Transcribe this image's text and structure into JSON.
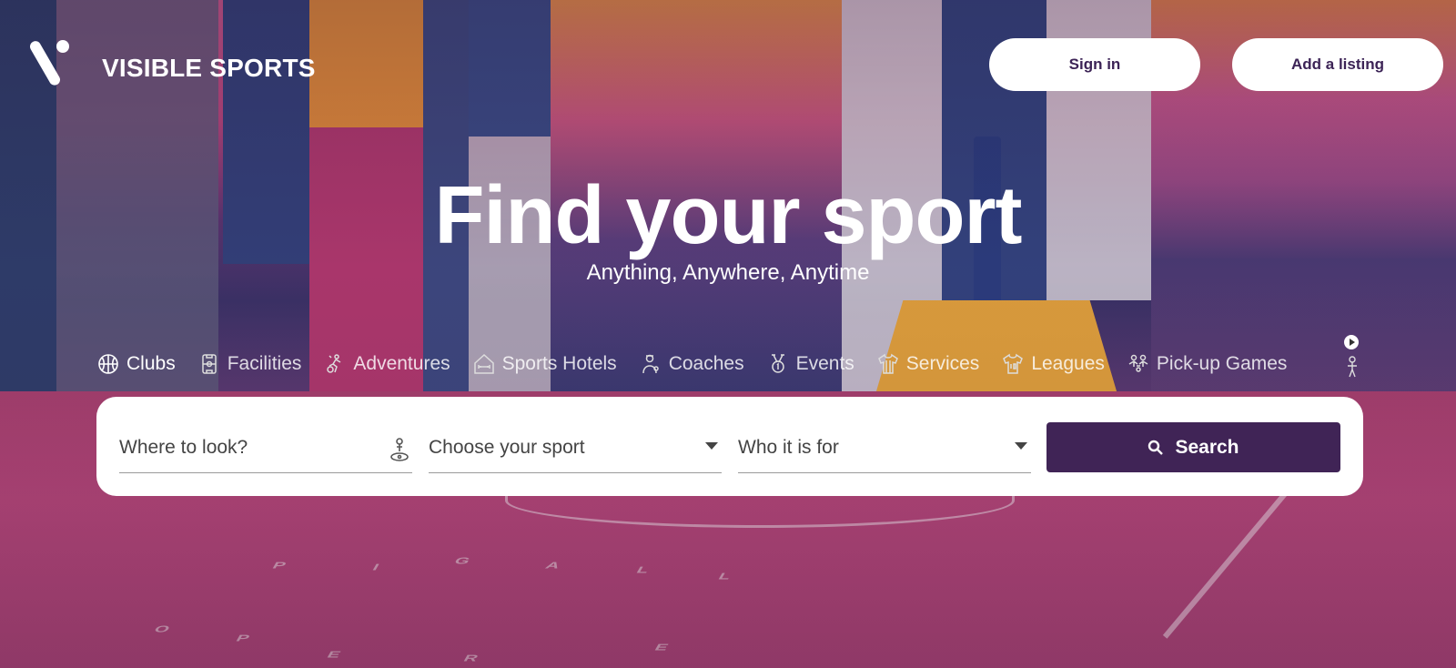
{
  "brand": {
    "name": "VISIBLE SPORTS"
  },
  "header": {
    "signin_label": "Sign in",
    "add_listing_label": "Add a listing"
  },
  "hero": {
    "title": "Find your sport",
    "subtitle": "Anything, Anywhere, Anytime"
  },
  "categories": [
    {
      "label": "Clubs",
      "icon": "basketball-icon",
      "active": true
    },
    {
      "label": "Facilities",
      "icon": "court-icon"
    },
    {
      "label": "Adventures",
      "icon": "climber-icon"
    },
    {
      "label": "Sports Hotels",
      "icon": "hotel-dumbbell-icon"
    },
    {
      "label": "Coaches",
      "icon": "coach-icon"
    },
    {
      "label": "Events",
      "icon": "medal-icon"
    },
    {
      "label": "Services",
      "icon": "referee-shirt-icon"
    },
    {
      "label": "Leagues",
      "icon": "jersey-icon"
    },
    {
      "label": "Pick-up Games",
      "icon": "players-icon"
    }
  ],
  "search": {
    "where_placeholder": "Where to look?",
    "sport_placeholder": "Choose your sport",
    "who_placeholder": "Who it is for",
    "button_label": "Search"
  },
  "colors": {
    "primary": "#402456",
    "button_text": "#3c2356",
    "card": "#ffffff"
  }
}
